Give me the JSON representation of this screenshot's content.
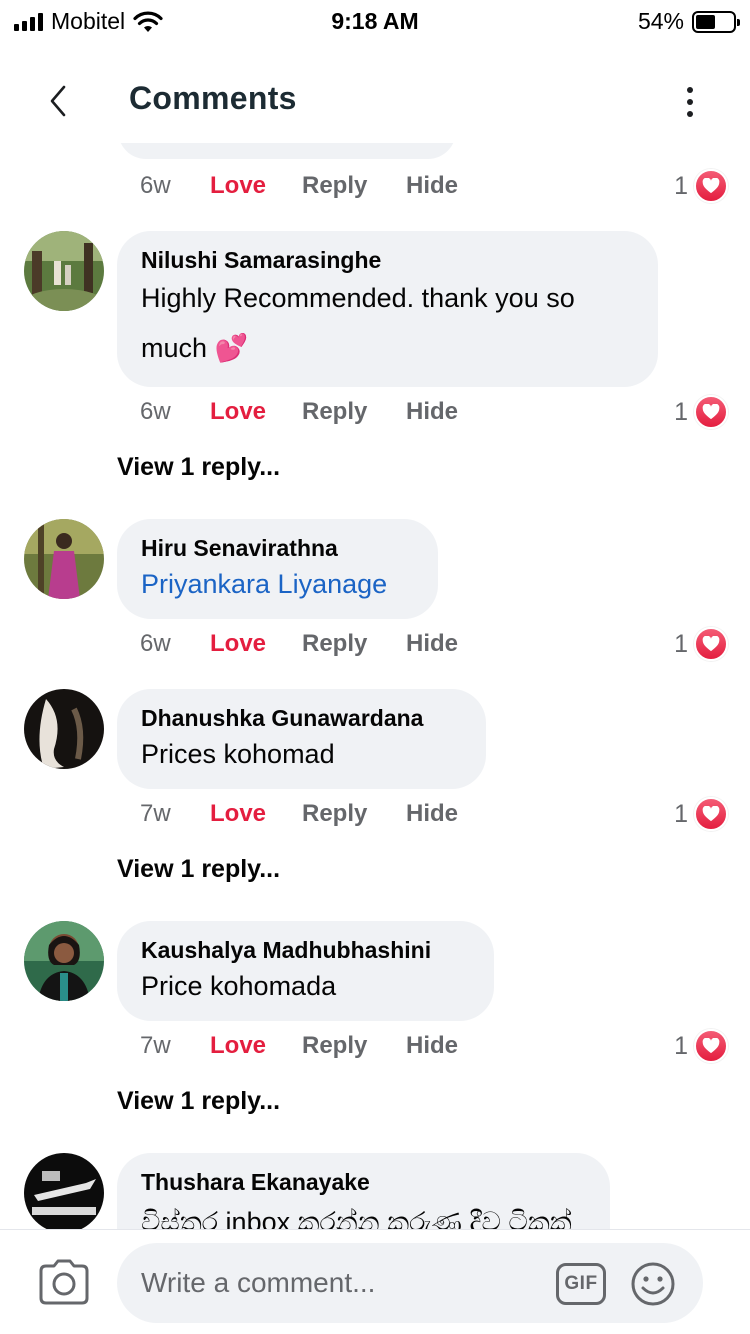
{
  "status_bar": {
    "carrier": "Mobitel",
    "time": "9:18 AM",
    "battery_percent": "54%",
    "battery_level": 0.54,
    "icons": [
      "signal-icon",
      "wifi-icon",
      "battery-icon"
    ]
  },
  "header": {
    "title": "Comments",
    "back_icon": "chevron-left-icon",
    "more_icon": "more-vertical-icon"
  },
  "comments": [
    {
      "author": "",
      "text": "",
      "time": "6w",
      "love_label": "Love",
      "reply_label": "Reply",
      "hide_label": "Hide",
      "reaction_count": "1"
    },
    {
      "author": "Nilushi Samarasinghe",
      "text_line1": "Highly Recommended. thank you so",
      "text_line2": "much 💕",
      "time": "6w",
      "love_label": "Love",
      "reply_label": "Reply",
      "hide_label": "Hide",
      "reaction_count": "1",
      "view_replies": "View 1 reply..."
    },
    {
      "author": "Hiru Senavirathna",
      "mention": "Priyankara Liyanage",
      "time": "6w",
      "love_label": "Love",
      "reply_label": "Reply",
      "hide_label": "Hide",
      "reaction_count": "1"
    },
    {
      "author": "Dhanushka Gunawardana",
      "text": "Prices kohomad",
      "time": "7w",
      "love_label": "Love",
      "reply_label": "Reply",
      "hide_label": "Hide",
      "reaction_count": "1",
      "view_replies": "View 1 reply..."
    },
    {
      "author": "Kaushalya Madhubhashini",
      "text": "Price kohomada",
      "time": "7w",
      "love_label": "Love",
      "reply_label": "Reply",
      "hide_label": "Hide",
      "reaction_count": "1",
      "view_replies": "View 1 reply..."
    },
    {
      "author": "Thushara Ekanayake",
      "text": "විස්තර inbox කරන්න කරුණ දීව ටිකක්"
    }
  ],
  "composer": {
    "placeholder": "Write a comment...",
    "gif_label": "GIF",
    "icons": [
      "camera-icon",
      "gif-icon",
      "emoji-icon"
    ]
  },
  "colors": {
    "love": "#e41e3f",
    "mention": "#1b64c5",
    "bubble": "#f0f2f5",
    "meta": "#65676b"
  }
}
